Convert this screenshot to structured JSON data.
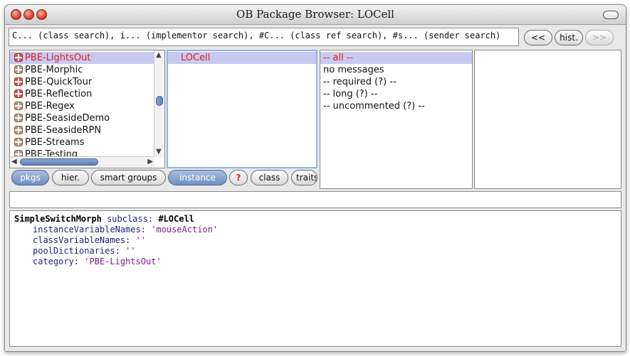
{
  "window": {
    "title": "OB Package Browser: LOCell"
  },
  "search": {
    "text": "C... (class search), i... (implementor search), #C... (class ref search), #s... (sender search)"
  },
  "history": {
    "back": "<<",
    "hist": "hist.",
    "forward": ">>"
  },
  "packages": [
    {
      "label": "PBE-LightsOut",
      "icon": "package-red-icon",
      "selected": true
    },
    {
      "label": "PBE-Morphic",
      "icon": "package-icon"
    },
    {
      "label": "PBE-QuickTour",
      "icon": "package-red-icon"
    },
    {
      "label": "PBE-Reflection",
      "icon": "package-red-icon"
    },
    {
      "label": "PBE-Regex",
      "icon": "package-icon"
    },
    {
      "label": "PBE-SeasideDemo",
      "icon": "package-icon"
    },
    {
      "label": "PBE-SeasideRPN",
      "icon": "package-icon"
    },
    {
      "label": "PBE-Streams",
      "icon": "package-icon"
    },
    {
      "label": "PBE-Testing",
      "icon": "package-icon"
    }
  ],
  "classes": [
    {
      "label": "LOCell",
      "selected": true
    }
  ],
  "protocols": [
    {
      "label": "-- all --",
      "selected": true
    },
    {
      "label": "no messages"
    },
    {
      "label": "-- required (?) --"
    },
    {
      "label": "-- long (?) --"
    },
    {
      "label": "-- uncommented (?) --"
    }
  ],
  "buttons": {
    "pkgs": "pkgs",
    "hier": "hier.",
    "smart": "smart groups",
    "instance": "instance",
    "help": "?",
    "class": "class",
    "traits": "traits"
  },
  "code": {
    "superclass": "SimpleSwitchMorph",
    "subclass_kw": "subclass:",
    "classname": "#LOCell",
    "ivn_kw": "instanceVariableNames:",
    "ivn": "'mouseAction'",
    "cvn_kw": "classVariableNames:",
    "cvn": "''",
    "pd_kw": "poolDictionaries:",
    "pd": "''",
    "cat_kw": "category:",
    "cat": "'PBE-LightsOut'"
  },
  "colors": {
    "selection": "#c9c9f0",
    "accent": "#6f8fc2",
    "selected_text": "#e0201a"
  }
}
